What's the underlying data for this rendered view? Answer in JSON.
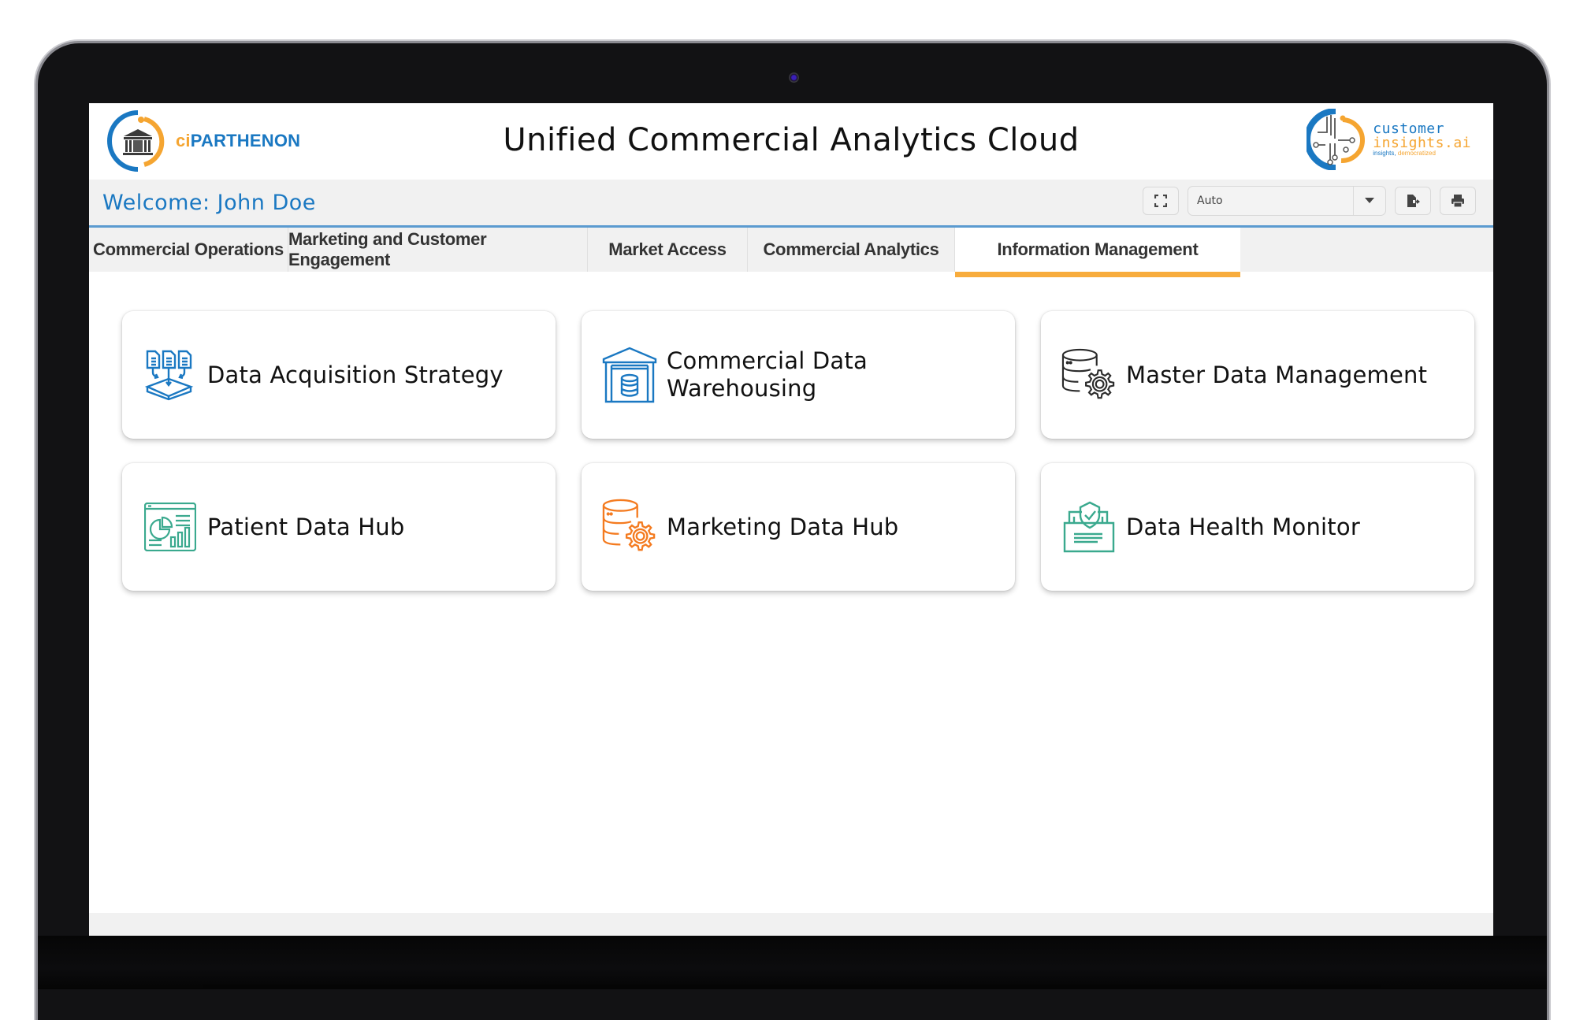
{
  "header": {
    "logo_left": {
      "prefix": "ci",
      "name": "PARTHENON"
    },
    "title": "Unified Commercial Analytics Cloud",
    "logo_right": {
      "line1": "customer",
      "line2": "insights.ai",
      "tagline_a": "insights,",
      "tagline_b": "democratized"
    }
  },
  "welcome_bar": {
    "welcome_text": "Welcome: John Doe",
    "toolbar": {
      "fullscreen_icon": "fullscreen-icon",
      "zoom_select_value": "Auto",
      "export_icon": "file-export-icon",
      "print_icon": "printer-icon"
    }
  },
  "tabs": [
    {
      "label": "Commercial Operations",
      "active": false
    },
    {
      "label": "Marketing and Customer Engagement",
      "active": false
    },
    {
      "label": "Market Access",
      "active": false
    },
    {
      "label": "Commercial Analytics",
      "active": false
    },
    {
      "label": "Information Management",
      "active": true
    }
  ],
  "cards": [
    {
      "label": "Data Acquisition Strategy",
      "icon": "documents-to-tray-icon",
      "color": "#1a78c2"
    },
    {
      "label": "Commercial Data Warehousing",
      "icon": "warehouse-database-icon",
      "color": "#1a78c2"
    },
    {
      "label": "Master Data Management",
      "icon": "database-gear-icon",
      "color": "#2b2b2b"
    },
    {
      "label": "Patient Data Hub",
      "icon": "dashboard-chart-icon",
      "color": "#3aa98e"
    },
    {
      "label": "Marketing Data Hub",
      "icon": "database-gear-icon",
      "color": "#f47b20"
    },
    {
      "label": "Data Health Monitor",
      "icon": "folder-shield-check-icon",
      "color": "#3aa98e"
    }
  ],
  "colors": {
    "brand_blue": "#1a78c2",
    "brand_orange": "#f5a531",
    "tab_accent": "#f8ac3c",
    "welcome_underline": "#5b9bd0"
  }
}
